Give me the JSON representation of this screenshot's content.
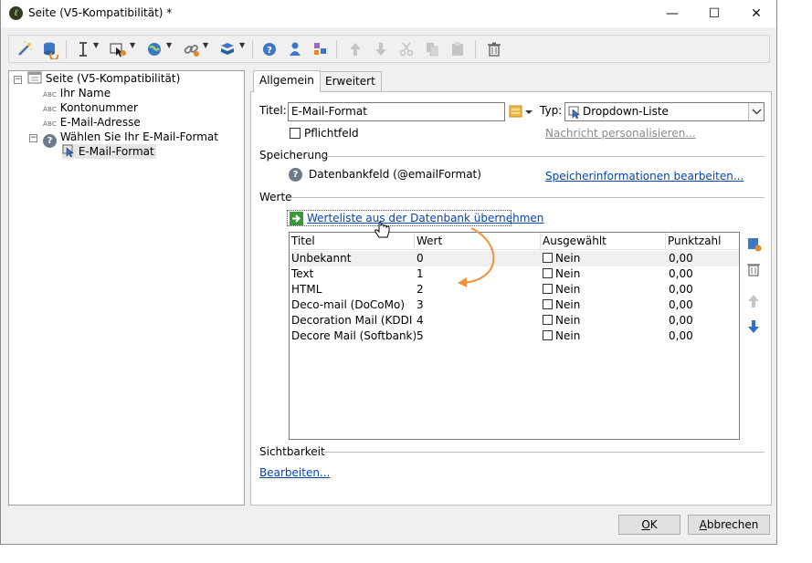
{
  "window": {
    "title": "Seite (V5-Kompatibilität) *",
    "controls": [
      "—",
      "☐",
      "✕"
    ]
  },
  "toolbar": {
    "buttons": [
      "wand-icon",
      "database-icon",
      "text-cursor-icon",
      "field-icon",
      "globe-icon",
      "link-icon",
      "stack-icon",
      "help-icon",
      "user-icon",
      "add-element-icon",
      "move-up-icon",
      "move-down-icon",
      "cut-icon",
      "copy-icon",
      "paste-icon",
      "delete-icon"
    ]
  },
  "tree": {
    "root": "Seite (V5-Kompatibilität)",
    "abc": "ABC",
    "items": [
      "Ihr Name",
      "Kontonummer",
      "E-Mail-Adresse"
    ],
    "group": "Wählen Sie Ihr E-Mail-Format",
    "child": "E-Mail-Format",
    "expander_open": "−"
  },
  "tabs": [
    "Allgemein",
    "Erweitert"
  ],
  "general": {
    "title_label": "Titel:",
    "title_value": "E-Mail-Format",
    "type_label": "Typ:",
    "type_value": "Dropdown-Liste",
    "required_label": "Pflichtfeld",
    "personalize_link": "Nachricht personalisieren...",
    "storage_section": "Speicherung",
    "storage_value": "Datenbankfeld (@emailFormat)",
    "storage_link": "Speicherinformationen bearbeiten...",
    "values_section": "Werte",
    "import_link": "Werteliste aus der Datenbank übernehmen",
    "visibility_section": "Sichtbarkeit",
    "visibility_link": "Bearbeiten..."
  },
  "grid": {
    "columns": [
      "Titel",
      "Wert",
      "Ausgewählt",
      "Punktzahl"
    ],
    "rows": [
      {
        "title": "Unbekannt",
        "value": "0",
        "selected": "Nein",
        "score": "0,00"
      },
      {
        "title": "Text",
        "value": "1",
        "selected": "Nein",
        "score": "0,00"
      },
      {
        "title": "HTML",
        "value": "2",
        "selected": "Nein",
        "score": "0,00"
      },
      {
        "title": "Deco-mail (DoCoMo)",
        "value": "3",
        "selected": "Nein",
        "score": "0,00"
      },
      {
        "title": "Decoration Mail (KDDI A...",
        "value": "4",
        "selected": "Nein",
        "score": "0,00"
      },
      {
        "title": "Decore Mail (Softbank)",
        "value": "5",
        "selected": "Nein",
        "score": "0,00"
      }
    ]
  },
  "footer": {
    "ok_mnemonic": "O",
    "ok_rest": "K",
    "cancel_mnemonic": "A",
    "cancel_rest": "bbrechen"
  },
  "colors": {
    "link": "#0645ad",
    "annotation_arrow": "#f0923a",
    "selection": "#f0f0f0"
  }
}
